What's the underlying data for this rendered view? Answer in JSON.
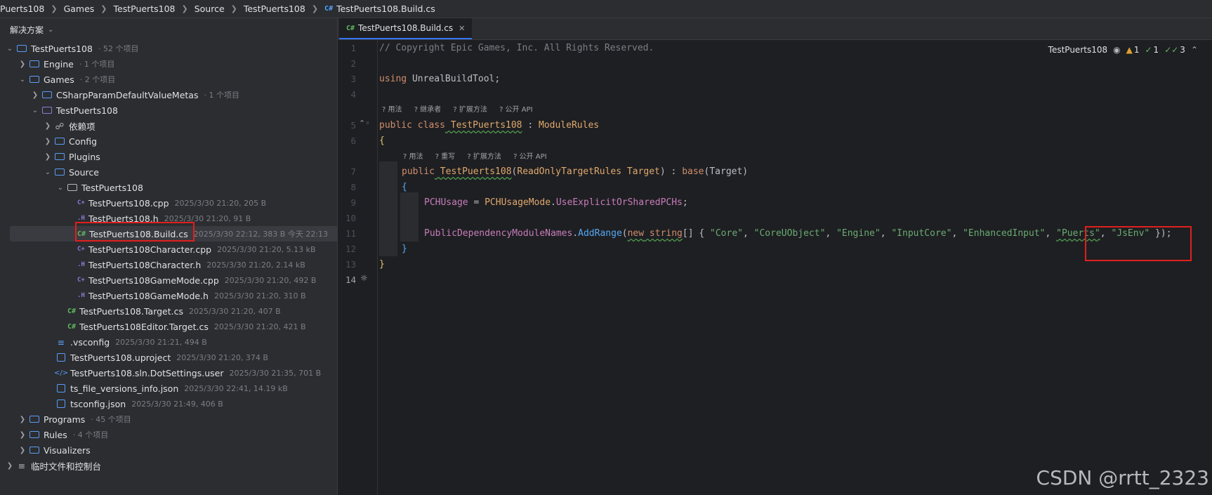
{
  "breadcrumb": [
    "Puerts108",
    "Games",
    "TestPuerts108",
    "Source",
    "TestPuerts108",
    "TestPuerts108.Build.cs"
  ],
  "breadcrumb_last_tag": "C#",
  "sidebar": {
    "title": "解决方案",
    "items": [
      {
        "label": "TestPuerts108",
        "meta": "· 52 个项目"
      },
      {
        "label": "Engine",
        "meta": "· 1 个项目"
      },
      {
        "label": "Games",
        "meta": "· 2 个项目"
      },
      {
        "label": "CSharpParamDefaultValueMetas",
        "meta": "· 1 个项目"
      },
      {
        "label": "TestPuerts108",
        "meta": ""
      },
      {
        "label": "依赖项",
        "meta": ""
      },
      {
        "label": "Config",
        "meta": ""
      },
      {
        "label": "Plugins",
        "meta": ""
      },
      {
        "label": "Source",
        "meta": ""
      },
      {
        "label": "TestPuerts108",
        "meta": ""
      },
      {
        "label": "TestPuerts108.cpp",
        "meta": "2025/3/30 21:20, 205 B"
      },
      {
        "label": "TestPuerts108.h",
        "meta": "2025/3/30 21:20, 91 B"
      },
      {
        "label": "TestPuerts108.Build.cs",
        "meta": "2025/3/30 22:12, 383 B 今天 22:13"
      },
      {
        "label": "TestPuerts108Character.cpp",
        "meta": "2025/3/30 21:20, 5.13 kB"
      },
      {
        "label": "TestPuerts108Character.h",
        "meta": "2025/3/30 21:20, 2.14 kB"
      },
      {
        "label": "TestPuerts108GameMode.cpp",
        "meta": "2025/3/30 21:20, 492 B"
      },
      {
        "label": "TestPuerts108GameMode.h",
        "meta": "2025/3/30 21:20, 310 B"
      },
      {
        "label": "TestPuerts108.Target.cs",
        "meta": "2025/3/30 21:20, 407 B"
      },
      {
        "label": "TestPuerts108Editor.Target.cs",
        "meta": "2025/3/30 21:20, 421 B"
      },
      {
        "label": ".vsconfig",
        "meta": "2025/3/30 21:21, 494 B"
      },
      {
        "label": "TestPuerts108.uproject",
        "meta": "2025/3/30 21:20, 374 B"
      },
      {
        "label": "TestPuerts108.sln.DotSettings.user",
        "meta": "2025/3/30 21:35, 701 B"
      },
      {
        "label": "ts_file_versions_info.json",
        "meta": "2025/3/30 22:41, 14.19 kB"
      },
      {
        "label": "tsconfig.json",
        "meta": "2025/3/30 21:49, 406 B"
      },
      {
        "label": "Programs",
        "meta": "· 45 个项目"
      },
      {
        "label": "Rules",
        "meta": "· 4 个项目"
      },
      {
        "label": "Visualizers",
        "meta": ""
      },
      {
        "label": "临时文件和控制台",
        "meta": ""
      }
    ]
  },
  "editor": {
    "tab_label": "TestPuerts108.Build.cs",
    "tab_tag": "C#",
    "status": {
      "project": "TestPuerts108",
      "warnings": "1",
      "checks": "1",
      "double_checks": "3"
    },
    "hints1": [
      "? 用法",
      "? 继承者",
      "? 扩展方法",
      "? 公开 API"
    ],
    "hints2": [
      "? 用法",
      "? 重写",
      "? 扩展方法",
      "? 公开 API"
    ],
    "line_numbers": [
      "1",
      "2",
      "3",
      "4",
      "5",
      "6",
      "7",
      "8",
      "9",
      "10",
      "11",
      "12",
      "13",
      "14"
    ],
    "code": {
      "l1": "// Copyright Epic Games, Inc. All Rights Reserved.",
      "l3_kw": "using",
      "l3_rest": " UnrealBuildTool;",
      "l5_kw1": "public",
      "l5_kw2": " class",
      "l5_name": " TestPuerts108",
      "l5_sep": " : ",
      "l5_base": "ModuleRules",
      "l6": "{",
      "l7_kw": "public",
      "l7_name": " TestPuerts108",
      "l7_open": "(",
      "l7_type": "ReadOnlyTargetRules",
      "l7_param": " Target",
      "l7_mid": ") : ",
      "l7_base": "base",
      "l7_end": "(Target)",
      "l8": "{",
      "l9_field": "PCHUsage",
      "l9_eq": " = ",
      "l9_type": "PCHUsageMode",
      "l9_dot": ".",
      "l9_val": "UseExplicitOrSharedPCHs",
      "l9_end": ";",
      "l11_field": "PublicDependencyModuleNames",
      "l11_dot": ".",
      "l11_method": "AddRange",
      "l11_open": "(",
      "l11_new": "new",
      "l11_type": " string",
      "l11_arr": "[] { ",
      "l11_strs": [
        "\"Core\"",
        "\"CoreUObject\"",
        "\"Engine\"",
        "\"InputCore\"",
        "\"EnhancedInput\"",
        "\"Puerts\"",
        "\"JsEnv\""
      ],
      "l11_end": " });",
      "l12": "}",
      "l13": "}"
    }
  },
  "watermark": "CSDN @rrtt_2323"
}
